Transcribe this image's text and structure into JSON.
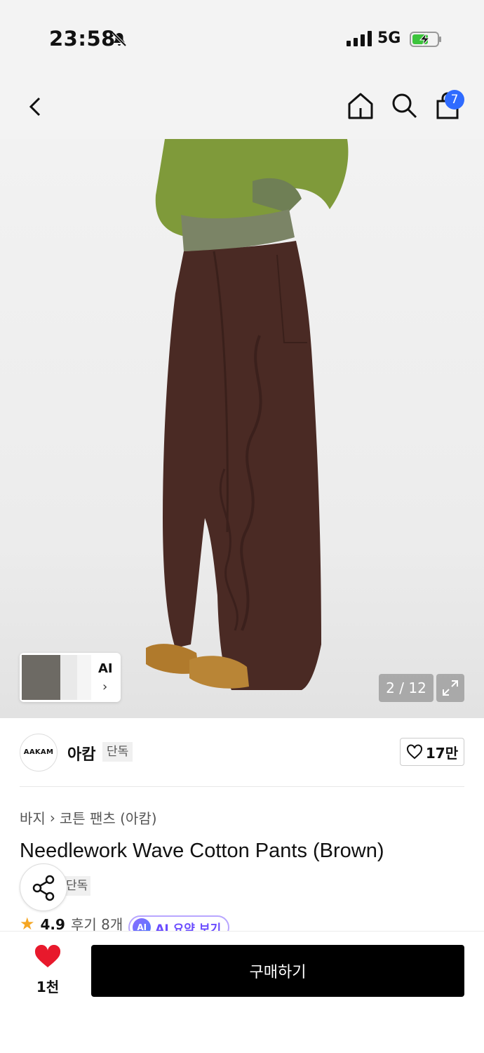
{
  "status_bar": {
    "time": "23:58",
    "network": "5G"
  },
  "nav": {
    "cart_count": "7"
  },
  "gallery": {
    "ai_label": "AI",
    "counter": "2 / 12"
  },
  "brand": {
    "logo_text": "AAKAM",
    "name": "아캄",
    "badge": "단독",
    "likes": "17만"
  },
  "product": {
    "breadcrumb": [
      "바지",
      "코튼 팬츠 (아캄)"
    ],
    "title": "Needlework Wave Cotton Pants (Brown)",
    "sub_badge": "단독",
    "rating": "4.9",
    "reviews": "후기 8개",
    "ai_summary_label": "AI 요약 보기",
    "ai_summary_icon": "AI"
  },
  "bottom": {
    "fav_count": "1천",
    "buy_label": "구매하기"
  },
  "colors": {
    "accent_blue": "#2f6bff",
    "heart_red": "#e8192c",
    "ai_purple": "#6a4cff",
    "star": "#f5a623"
  }
}
